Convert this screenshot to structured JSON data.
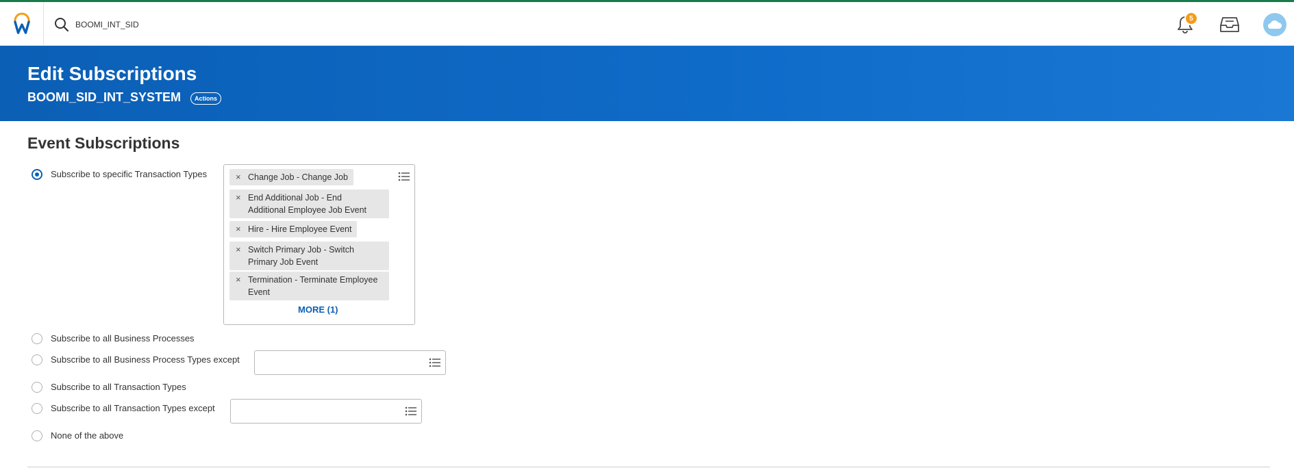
{
  "topbar": {
    "search_value": "BOOMI_INT_SID",
    "notification_count": "5",
    "colors": {
      "top_line": "#1a7a4c",
      "badge": "#f39c19",
      "avatar": "#8ec8ee"
    },
    "icons": [
      "workday-logo-icon",
      "search-icon",
      "bell-icon",
      "inbox-icon",
      "cloud-avatar-icon"
    ]
  },
  "header": {
    "title": "Edit Subscriptions",
    "subtitle": "BOOMI_SID_INT_SYSTEM",
    "actions_label": "Actions",
    "colors": {
      "band_start": "#0b5fb5",
      "band_end": "#1a78d4"
    }
  },
  "section": {
    "title": "Event Subscriptions"
  },
  "options": [
    {
      "label": "Subscribe to specific Transaction Types",
      "selected": true
    },
    {
      "label": "Subscribe to all Business Processes",
      "selected": false
    },
    {
      "label": "Subscribe to all Business Process Types except",
      "selected": false
    },
    {
      "label": "Subscribe to all Transaction Types",
      "selected": false
    },
    {
      "label": "Subscribe to all Transaction Types except",
      "selected": false
    },
    {
      "label": "None of the above",
      "selected": false
    }
  ],
  "transaction_types": {
    "selected": [
      {
        "line1": "Change Job - Change Job",
        "line2": ""
      },
      {
        "line1": "End Additional Job - End",
        "line2": "Additional Employee Job Event"
      },
      {
        "line1": "Hire - Hire Employee Event",
        "line2": ""
      },
      {
        "line1": "Switch Primary Job - Switch",
        "line2": "Primary Job Event"
      },
      {
        "line1": "Termination - Terminate Employee",
        "line2": "Event"
      }
    ],
    "remove_glyph": "×",
    "more_label": "MORE (1)"
  },
  "accent_color": "#0b5fb5"
}
